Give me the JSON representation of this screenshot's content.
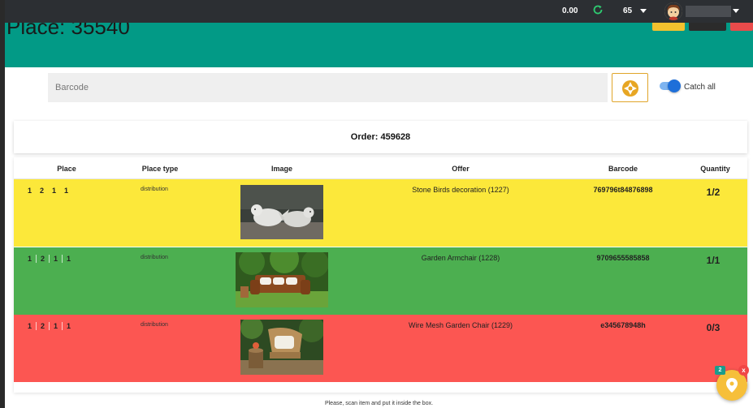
{
  "topbar": {
    "balance": "0.00",
    "count": "65",
    "refresh_icon": "refresh-icon",
    "user_icon": "user-avatar"
  },
  "header": {
    "title": "Place: 35540",
    "bg_color": "#029a86"
  },
  "scan": {
    "placeholder": "Barcode",
    "camera_icon": "aperture-icon",
    "catch_all_label": "Catch all",
    "catch_all_on": true
  },
  "order": {
    "label": "Order: 459628"
  },
  "table": {
    "headers": [
      "Place",
      "Place type",
      "Image",
      "Offer",
      "Barcode",
      "Quantity"
    ],
    "rows": [
      {
        "place": [
          "1",
          "2",
          "1",
          "1"
        ],
        "place_type": "distribution",
        "image": "stone-birds-photo",
        "offer": "Stone Birds decoration (1227)",
        "barcode": "769796t84876898",
        "quantity": "1/2",
        "color": "#fce83a"
      },
      {
        "place": [
          "1",
          "2",
          "1",
          "1"
        ],
        "place_type": "distribution",
        "image": "garden-armchair-photo",
        "offer": "Garden Armchair (1228)",
        "barcode": "9709655585858",
        "quantity": "1/1",
        "color": "#4caf50"
      },
      {
        "place": [
          "1",
          "2",
          "1",
          "1"
        ],
        "place_type": "distribution",
        "image": "wire-mesh-chair-photo",
        "offer": "Wire Mesh Garden Chair (1229)",
        "barcode": "e345678948h",
        "quantity": "0/3",
        "color": "#fc5652"
      }
    ]
  },
  "footer": {
    "note": "Please, scan item and put it inside the box."
  },
  "fab": {
    "badge": "2",
    "close": "x",
    "icon": "location-pin-icon"
  }
}
